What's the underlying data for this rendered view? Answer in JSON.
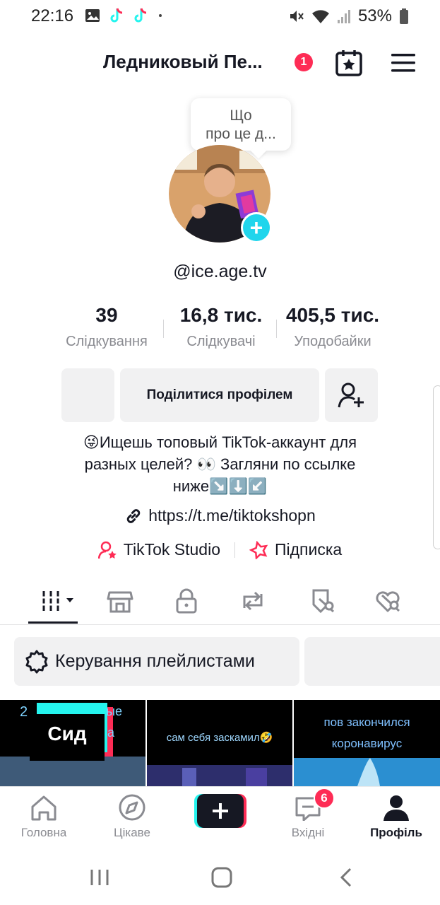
{
  "status_bar": {
    "time": "22:16",
    "battery": "53%"
  },
  "header": {
    "title": "Ледниковый Пе...",
    "notification_count": "1"
  },
  "profile": {
    "bubble_text_line1": "Що",
    "bubble_text_line2": "про це д...",
    "handle": "@ice.age.tv",
    "stats": [
      {
        "value": "39",
        "label": "Слідкування"
      },
      {
        "value": "16,8 тис.",
        "label": "Слідкувачі"
      },
      {
        "value": "405,5 тис.",
        "label": "Уподобайки"
      }
    ],
    "share_button": "Поділитися профілем",
    "bio_line1": "😜Ищешь топовый TikTok-аккаунт для",
    "bio_line2": "разных целей? 👀 Загляни по ссылке",
    "bio_line3": "ниже↘️⬇️↙️",
    "link": "https://t.me/tiktokshopn",
    "studio_label": "TikTok Studio",
    "subscription_label": "Підписка"
  },
  "tabs": [
    {
      "icon": "videos-grid-icon"
    },
    {
      "icon": "shop-icon"
    },
    {
      "icon": "lock-icon"
    },
    {
      "icon": "repost-icon"
    },
    {
      "icon": "favorites-icon"
    },
    {
      "icon": "liked-icon"
    }
  ],
  "playlist_button": "Керування плейлистами",
  "videos": [
    {
      "overlay": "Сид",
      "caption_line1": "2",
      "caption_line2": "ые",
      "caption_line3": "а"
    },
    {
      "caption": "сам себя заскамил🤣"
    },
    {
      "caption_line1": "пов закончился",
      "caption_line2": "коронавирус"
    }
  ],
  "bottom_nav": {
    "home": "Головна",
    "discover": "Цікаве",
    "inbox": "Вхідні",
    "inbox_badge": "6",
    "profile": "Профіль"
  },
  "colors": {
    "accent": "#fe2c55",
    "teal": "#20d5ec",
    "text": "#161823",
    "muted": "#8a8b91",
    "button_bg": "#f1f1f2"
  }
}
